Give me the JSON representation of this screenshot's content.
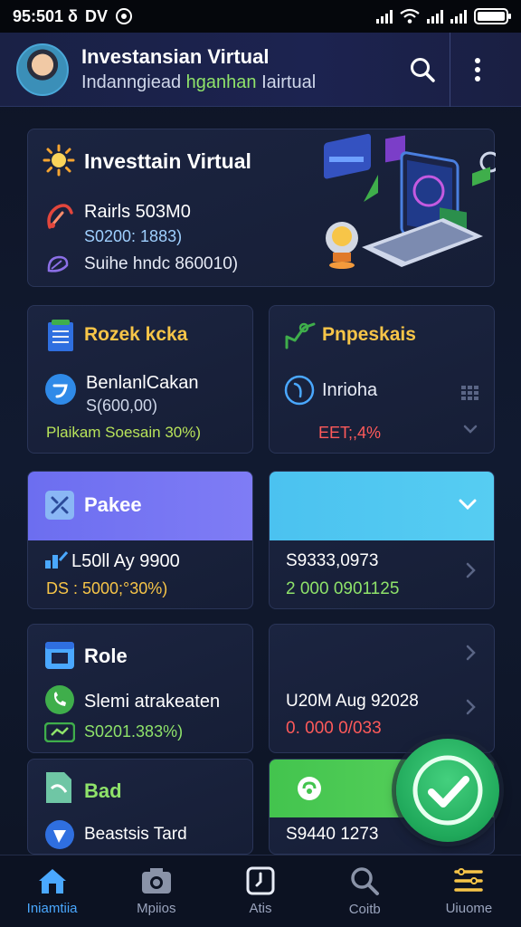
{
  "status_bar": {
    "time": "95:501 δ",
    "extra": "DV"
  },
  "header": {
    "title": "Investansian Virtual",
    "subtitle_a": "Indanngiead ",
    "subtitle_b": "hganhan",
    "subtitle_c": " Iairtual"
  },
  "hero": {
    "title": "Investtain Virtual",
    "line1": "Rairls 503M0",
    "line2": "S0200: 1883)",
    "line3": "Suihe hndc 860010)"
  },
  "left_mid": {
    "title": "Rozek kcka",
    "name": "BenlanlCakan",
    "value": "S(600,00)",
    "footer": "Plaikam Soesain 30%)"
  },
  "right_mid": {
    "title": "Pnpeskais",
    "name": "Inrioha",
    "footer": "EET;,4%"
  },
  "left_band": {
    "title": "Pakee",
    "line1": "L50ll Ay 9900",
    "line2": "DS : 5000;°30%)"
  },
  "right_band": {
    "line1": "S9333,0973",
    "line2": "2 000 0901125"
  },
  "left_low": {
    "title": "Role",
    "line1": "Slemi atrakeaten",
    "line2": "S0201.383%)"
  },
  "right_low": {
    "line1": "U20M Aug 92028",
    "line2": "0. 000 0/033"
  },
  "left_bottom": {
    "title": "Bad",
    "line1": "Beastsis Tard"
  },
  "right_bottom": {
    "line1": "S9440 1273"
  },
  "nav": [
    {
      "label": "Iniamtiia",
      "icon": "home-icon"
    },
    {
      "label": "Mpiios",
      "icon": "camera-icon"
    },
    {
      "label": "Atis",
      "icon": "clock-icon"
    },
    {
      "label": "Coitb",
      "icon": "search-icon"
    },
    {
      "label": "Uiuome",
      "icon": "menu-icon"
    }
  ],
  "colors": {
    "accent_purple": "#6c6ef0",
    "accent_cyan": "#4bc2f0",
    "accent_green": "#43c44e",
    "positive": "#8fe36a",
    "negative": "#ff5a5a",
    "gold": "#f7c548"
  }
}
